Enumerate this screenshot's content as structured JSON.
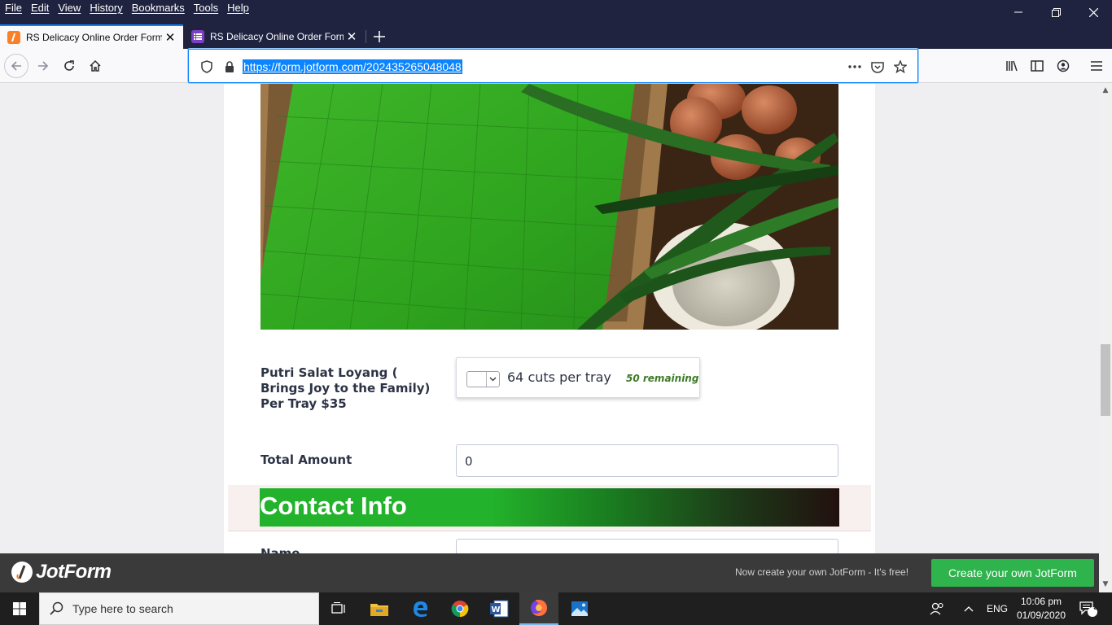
{
  "menubar": {
    "items": [
      "File",
      "Edit",
      "View",
      "History",
      "Bookmarks",
      "Tools",
      "Help"
    ]
  },
  "tabs": [
    {
      "title": "RS Delicacy Online Order Form",
      "active": true
    },
    {
      "title": "RS Delicacy Online Order Form",
      "active": false
    }
  ],
  "addressbar": {
    "url": "https://form.jotform.com/202435265048048"
  },
  "form": {
    "product": {
      "label": "Putri Salat Loyang ( Brings Joy to the Family) Per Tray $35",
      "option_text": "64 cuts per tray",
      "remaining": "50 remaining",
      "quantity_value": ""
    },
    "total": {
      "label": "Total Amount",
      "value": "0"
    },
    "section": {
      "title": "Contact Info"
    },
    "name": {
      "label": "Name"
    }
  },
  "jotform_bar": {
    "logo_text": "JotForm",
    "promo_text": "Now create your own JotForm - It's free!",
    "cta_label": "Create your own JotForm"
  },
  "taskbar": {
    "search_placeholder": "Type here to search",
    "language": "ENG",
    "time": "10:06 pm",
    "date": "01/09/2020",
    "notification_count": "3"
  },
  "colors": {
    "firefox_chrome": "#202340",
    "accent_blue": "#0a84ff",
    "jotform_green": "#2eb34d",
    "remaining_green": "#3d7b27"
  }
}
